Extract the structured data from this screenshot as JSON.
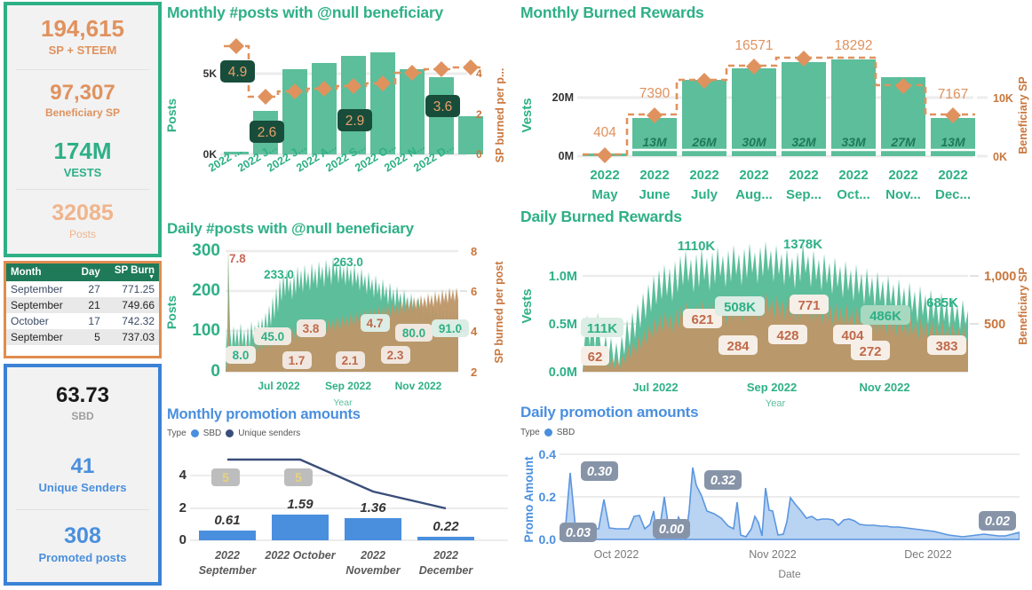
{
  "theme": {
    "green": "#2EB086",
    "green_fill": "#5CBE9B",
    "green_dark": "#1F7A5A",
    "orange": "#E0925E",
    "orange_light": "#EFA989",
    "tan": "#BE9668",
    "blue": "#4A8FDE",
    "blue_dark": "#3A4E7A",
    "grey": "#ADADAD",
    "label_bg": "#F6EFE8",
    "tooltip_dark": "#184D3B"
  },
  "kpi_green": {
    "items": [
      {
        "value": "194,615",
        "label": "SP + STEEM",
        "value_color": "#E0925E",
        "label_color": "#E0925E",
        "value_size": 26,
        "label_size": 13
      },
      {
        "value": "97,307",
        "label": "Beneficiary SP",
        "value_color": "#E0925E",
        "label_color": "#E0925E",
        "value_size": 24,
        "label_size": 12
      },
      {
        "value": "174M",
        "label": "VESTS",
        "value_color": "#2EB086",
        "label_color": "#2EB086",
        "value_size": 26,
        "label_size": 13
      },
      {
        "value": "32085",
        "label": "Posts",
        "value_color": "#F0B48C",
        "label_color": "#F0B48C",
        "value_size": 25,
        "label_size": 12
      }
    ]
  },
  "table": {
    "columns": [
      "Month",
      "Day",
      "SP Burn"
    ],
    "sorted_column": "SP Burn",
    "rows": [
      {
        "month": "September",
        "day": "27",
        "burn": "771.25"
      },
      {
        "month": "September",
        "day": "21",
        "burn": "749.66"
      },
      {
        "month": "October",
        "day": "17",
        "burn": "742.32"
      },
      {
        "month": "September",
        "day": "5",
        "burn": "737.03"
      }
    ]
  },
  "kpi_blue": {
    "items": [
      {
        "value": "63.73",
        "label": "SBD",
        "value_color": "#1A1A1A",
        "label_color": "#9E9E9E",
        "value_size": 24,
        "label_size": 12
      },
      {
        "value": "41",
        "label": "Unique Senders",
        "value_color": "#4A8FDE",
        "label_color": "#4A8FDE",
        "value_size": 24,
        "label_size": 13
      },
      {
        "value": "308",
        "label": "Promoted posts",
        "value_color": "#4A8FDE",
        "label_color": "#4A8FDE",
        "value_size": 25,
        "label_size": 13
      }
    ]
  },
  "chart_data": [
    {
      "id": "monthly_posts",
      "type": "bar",
      "title": "Monthly #posts with @null beneficiary",
      "xlabel": "",
      "ylabel": "Posts",
      "y2label": "SP burned per p...",
      "categories": [
        "2022 ...",
        "2022 J...",
        "2022 J...",
        "2022 A...",
        "2022 S...",
        "2022 O...",
        "2022 N...",
        "2022 D..."
      ],
      "ylim": [
        0,
        7000
      ],
      "yticks": [
        0,
        5000
      ],
      "yticklabels": [
        "0K",
        "5K"
      ],
      "y2lim": [
        0,
        5.6
      ],
      "y2ticks": [
        0,
        2,
        4
      ],
      "y2ticklabels": [
        "0",
        "2",
        "4"
      ],
      "series": [
        {
          "name": "Posts",
          "type": "bar",
          "color": "#5CBE9B",
          "values": [
            120,
            2700,
            5300,
            5700,
            6100,
            6300,
            5300,
            4800,
            2400
          ]
        },
        {
          "name": "SP burned per post",
          "type": "line-step",
          "color": "#E0925E",
          "values": [
            4.9,
            2.6,
            2.75,
            2.85,
            2.9,
            2.95,
            3.4,
            3.55,
            3.6
          ]
        }
      ],
      "bar_values": [
        120,
        2700,
        5300,
        5700,
        6100,
        6300,
        5300,
        4800,
        2400
      ],
      "line_values": [
        4.9,
        2.6,
        2.75,
        2.85,
        2.9,
        2.95,
        3.4,
        3.55,
        3.6
      ],
      "data_labels": [
        {
          "text": "4.9",
          "style": "dark"
        },
        {
          "text": "2.6",
          "style": "dark"
        },
        {
          "text": "2.9",
          "style": "dark"
        },
        {
          "text": "3.6",
          "style": "dark"
        }
      ]
    },
    {
      "id": "monthly_burned",
      "type": "bar",
      "title": "Monthly Burned Rewards",
      "xlabel": "",
      "ylabel": "Vests",
      "y2label": "Beneficiary SP",
      "categories": [
        "2022\nMay",
        "2022\nJune",
        "2022\nJuly",
        "2022\nAug...",
        "2022\nSep...",
        "2022\nOct...",
        "2022\nNov...",
        "2022\nDec..."
      ],
      "ylim": [
        0,
        36000000
      ],
      "yticks": [
        0,
        20000000
      ],
      "yticklabels": [
        "0M",
        "20M"
      ],
      "y2lim": [
        0,
        20000
      ],
      "y2ticks": [
        0,
        10000
      ],
      "y2ticklabels": [
        "0K",
        "10K"
      ],
      "series": [
        {
          "name": "Vests",
          "type": "bar",
          "color": "#5CBE9B",
          "values": [
            400000,
            13000000,
            26000000,
            30000000,
            32000000,
            33000000,
            27000000,
            13000000
          ]
        },
        {
          "name": "Beneficiary SP",
          "type": "line-step",
          "color": "#E0925E",
          "values": [
            404,
            7390,
            13000,
            15600,
            16900,
            16900,
            12100,
            7167
          ]
        }
      ],
      "bar_labels": [
        "",
        "13M",
        "26M",
        "30M",
        "32M",
        "33M",
        "27M",
        "13M"
      ],
      "line_labels": [
        "404",
        "7390",
        "",
        "16571",
        "",
        "18292",
        "",
        "7167"
      ]
    },
    {
      "id": "daily_posts",
      "type": "area",
      "title": "Daily #posts with @null beneficiary",
      "xlabel": "Year",
      "ylabel": "Posts",
      "y2label": "SP burned per post",
      "ylim": [
        0,
        300
      ],
      "yticks": [
        0,
        100,
        200,
        300
      ],
      "yticklabels": [
        "0",
        "100",
        "200",
        "300"
      ],
      "y2lim": [
        0,
        8
      ],
      "y2ticks": [
        0,
        2,
        4,
        6,
        8
      ],
      "y2ticklabels": [
        "0",
        "2",
        "4",
        "6",
        "8"
      ],
      "xticklabels": [
        "Jul 2022",
        "Sep 2022",
        "Nov 2022"
      ],
      "series": [
        {
          "name": "Posts",
          "color": "#5CBE9B"
        },
        {
          "name": "SP burned per post",
          "color": "#BE9668"
        }
      ],
      "annotations": [
        {
          "text": "7.8",
          "color": "#C86A5A"
        },
        {
          "text": "233.0",
          "color": "#2EB086"
        },
        {
          "text": "263.0",
          "color": "#2EB086"
        },
        {
          "text": "8.0",
          "color": "#2EB086"
        },
        {
          "text": "45.0",
          "color": "#2EB086"
        },
        {
          "text": "3.8",
          "color": "#C06A4A"
        },
        {
          "text": "1.7",
          "color": "#C06A4A"
        },
        {
          "text": "2.1",
          "color": "#C06A4A"
        },
        {
          "text": "4.7",
          "color": "#C06A4A"
        },
        {
          "text": "2.3",
          "color": "#C06A4A"
        },
        {
          "text": "80.0",
          "color": "#2EB086"
        },
        {
          "text": "91.0",
          "color": "#2EB086"
        }
      ]
    },
    {
      "id": "daily_burned",
      "type": "area",
      "title": "Daily Burned Rewards",
      "xlabel": "Year",
      "ylabel": "Vests",
      "y2label": "Beneficiary SP",
      "ylim": [
        0,
        1500000
      ],
      "yticks": [
        0,
        500000,
        1000000
      ],
      "yticklabels": [
        "0.0M",
        "0.5M",
        "1.0M"
      ],
      "y2lim": [
        0,
        1200
      ],
      "y2ticks": [
        500,
        1000
      ],
      "y2ticklabels": [
        "500",
        "1,000"
      ],
      "xticklabels": [
        "Jul 2022",
        "Sep 2022",
        "Nov 2022"
      ],
      "series": [
        {
          "name": "Vests",
          "color": "#5CBE9B"
        },
        {
          "name": "Beneficiary SP",
          "color": "#BE9668"
        }
      ],
      "annotations": [
        {
          "text": "1110K",
          "color": "#2EB086"
        },
        {
          "text": "1378K",
          "color": "#2EB086"
        },
        {
          "text": "111K",
          "color": "#2EB086"
        },
        {
          "text": "62",
          "color": "#C06A4A"
        },
        {
          "text": "621",
          "color": "#C06A4A"
        },
        {
          "text": "508K",
          "color": "#2EB086"
        },
        {
          "text": "284",
          "color": "#C06A4A"
        },
        {
          "text": "428",
          "color": "#C06A4A"
        },
        {
          "text": "771",
          "color": "#C06A4A"
        },
        {
          "text": "404",
          "color": "#C06A4A"
        },
        {
          "text": "272",
          "color": "#C06A4A"
        },
        {
          "text": "486K",
          "color": "#2EB086"
        },
        {
          "text": "685K",
          "color": "#2EB086"
        },
        {
          "text": "383",
          "color": "#C06A4A"
        }
      ]
    },
    {
      "id": "monthly_promo",
      "type": "bar",
      "title": "Monthly promotion amounts",
      "legend_title": "Type",
      "legend": [
        {
          "label": "SBD",
          "color": "#4A8FDE"
        },
        {
          "label": "Unique senders",
          "color": "#3A4E7A"
        }
      ],
      "categories": [
        "2022\nSeptember",
        "2022 October",
        "2022\nNovember",
        "2022\nDecember"
      ],
      "ylim": [
        0,
        5.4
      ],
      "yticks": [
        0,
        2,
        4
      ],
      "yticklabels": [
        "0",
        "2",
        "4"
      ],
      "series": [
        {
          "name": "SBD",
          "type": "bar",
          "color": "#4A8FDE",
          "values": [
            0.61,
            1.59,
            1.36,
            0.22
          ]
        },
        {
          "name": "Unique senders",
          "type": "line",
          "color": "#3A4E7A",
          "values": [
            5,
            5,
            3,
            2
          ]
        }
      ],
      "bar_labels": [
        "0.61",
        "1.59",
        "1.36",
        "0.22"
      ],
      "line_labels": [
        "5",
        "5",
        "",
        ""
      ]
    },
    {
      "id": "daily_promo",
      "type": "area",
      "title": "Daily promotion amounts",
      "legend_title": "Type",
      "legend": [
        {
          "label": "SBD",
          "color": "#4A8FDE"
        }
      ],
      "xlabel": "Date",
      "ylabel": "Promo Amount",
      "ylim": [
        0,
        0.4
      ],
      "yticks": [
        0,
        0.2,
        0.4
      ],
      "yticklabels": [
        "0.0",
        "0.2",
        "0.4"
      ],
      "xticklabels": [
        "Oct 2022",
        "Nov 2022",
        "Dec 2022"
      ],
      "annotations": [
        {
          "text": "0.30"
        },
        {
          "text": "0.03"
        },
        {
          "text": "0.00"
        },
        {
          "text": "0.32"
        },
        {
          "text": "0.02"
        }
      ]
    }
  ]
}
